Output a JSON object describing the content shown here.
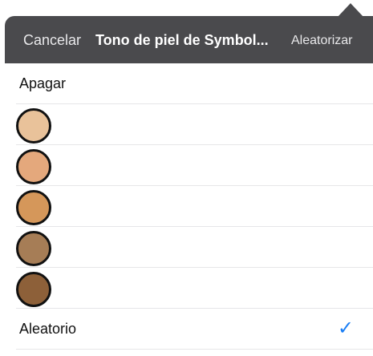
{
  "header": {
    "cancel_label": "Cancelar",
    "title": "Tono de piel de Symbol...",
    "random_label": "Aleatorizar"
  },
  "options": {
    "off_label": "Apagar",
    "random_label": "Aleatorio",
    "selected": "Aleatorio",
    "check_glyph": "✓"
  },
  "skin_tones": [
    {
      "name": "light",
      "color": "#e9c29a"
    },
    {
      "name": "medium-light",
      "color": "#e4a87c"
    },
    {
      "name": "medium",
      "color": "#d5975a"
    },
    {
      "name": "medium-dark",
      "color": "#a67d56"
    },
    {
      "name": "dark",
      "color": "#8d6039"
    }
  ],
  "colors": {
    "header_bg": "#4a4a4d",
    "accent": "#1a7ef5",
    "separator": "#e6e6e8"
  }
}
